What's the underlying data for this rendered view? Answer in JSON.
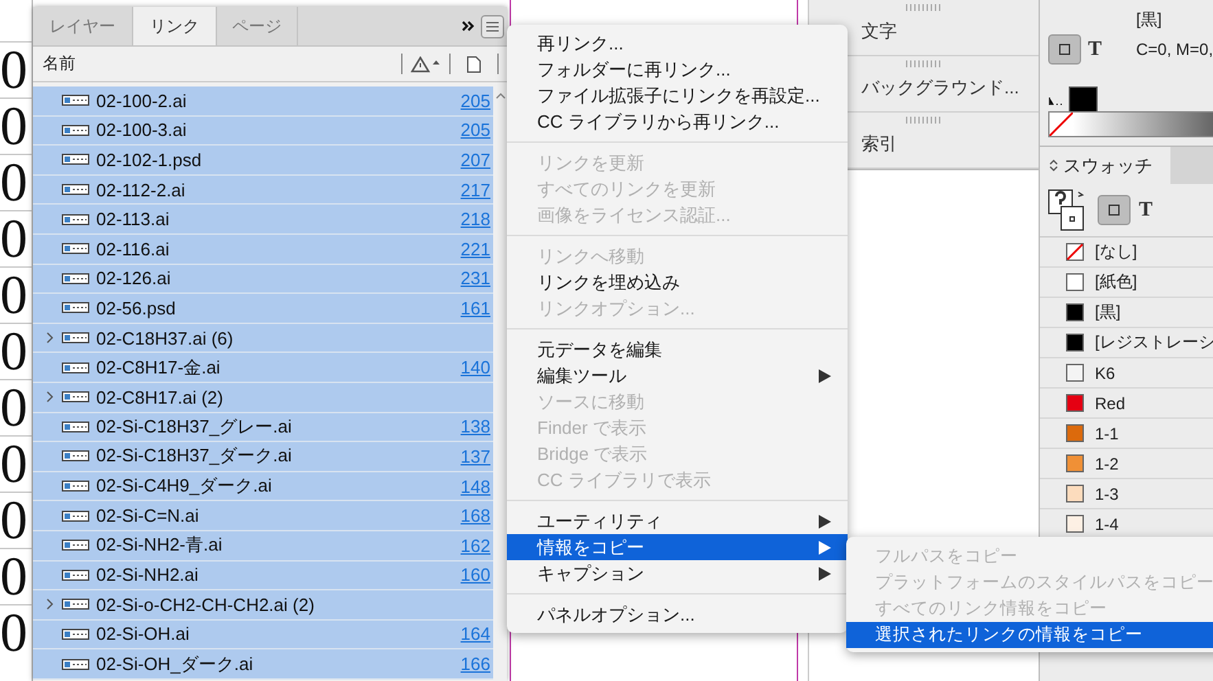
{
  "document": {
    "cells": [
      "0",
      "0",
      "0",
      "0",
      "0",
      "0",
      "0",
      "0",
      "0",
      "0",
      "0"
    ]
  },
  "links_panel": {
    "tabs": [
      {
        "label": "レイヤー",
        "selected": false
      },
      {
        "label": "リンク",
        "selected": true
      },
      {
        "label": "ページ",
        "selected": false
      }
    ],
    "name_column": "名前",
    "rows": [
      {
        "kind": "file",
        "name": "02-100-2.ai",
        "page": "205",
        "selected": true
      },
      {
        "kind": "file",
        "name": "02-100-3.ai",
        "page": "205",
        "selected": true
      },
      {
        "kind": "file",
        "name": "02-102-1.psd",
        "page": "207",
        "selected": true
      },
      {
        "kind": "file",
        "name": "02-112-2.ai",
        "page": "217",
        "selected": true
      },
      {
        "kind": "file",
        "name": "02-113.ai",
        "page": "218",
        "selected": true
      },
      {
        "kind": "file",
        "name": "02-116.ai",
        "page": "221",
        "selected": true
      },
      {
        "kind": "file",
        "name": "02-126.ai",
        "page": "231",
        "selected": true
      },
      {
        "kind": "file",
        "name": "02-56.psd",
        "page": "161",
        "selected": true
      },
      {
        "kind": "group",
        "name": "02-C18H37.ai (6)",
        "selected": true
      },
      {
        "kind": "file",
        "name": "02-C8H17-金.ai",
        "page": "140",
        "selected": true
      },
      {
        "kind": "group",
        "name": "02-C8H17.ai (2)",
        "selected": true
      },
      {
        "kind": "file",
        "name": "02-Si-C18H37_グレー.ai",
        "page": "138",
        "selected": true
      },
      {
        "kind": "file",
        "name": "02-Si-C18H37_ダーク.ai",
        "page": "137",
        "selected": true
      },
      {
        "kind": "file",
        "name": "02-Si-C4H9_ダーク.ai",
        "page": "148",
        "selected": true
      },
      {
        "kind": "file",
        "name": "02-Si-C=N.ai",
        "page": "168",
        "selected": true
      },
      {
        "kind": "file",
        "name": "02-Si-NH2-青.ai",
        "page": "162",
        "selected": true
      },
      {
        "kind": "file",
        "name": "02-Si-NH2.ai",
        "page": "160",
        "selected": true
      },
      {
        "kind": "group",
        "name": "02-Si-o-CH2-CH-CH2.ai (2)",
        "selected": true
      },
      {
        "kind": "file",
        "name": "02-Si-OH.ai",
        "page": "164",
        "selected": true
      },
      {
        "kind": "file",
        "name": "02-Si-OH_ダーク.ai",
        "page": "166",
        "selected": true
      }
    ]
  },
  "collapsed_panels": [
    {
      "label": "文字"
    },
    {
      "label": "バックグラウンド..."
    },
    {
      "label": "索引"
    }
  ],
  "color_panel": {
    "swatch_name": "[黒]",
    "format_label": "T",
    "values": "C=0, M=0,"
  },
  "swatches_panel": {
    "tab": "スウォッチ",
    "format_label": "T",
    "swatches": [
      {
        "kind": "none",
        "name": "[なし]"
      },
      {
        "kind": "color",
        "name": "[紙色]",
        "color": "#ffffff"
      },
      {
        "kind": "color",
        "name": "[黒]",
        "color": "#000000"
      },
      {
        "kind": "color",
        "name": "[レジストレーシ",
        "color": "#000000"
      },
      {
        "kind": "color",
        "name": "K6",
        "color": "#f4f4f4"
      },
      {
        "kind": "color",
        "name": "Red",
        "color": "#e50012"
      },
      {
        "kind": "color",
        "name": "1-1",
        "color": "#dc6a0c"
      },
      {
        "kind": "color",
        "name": "1-2",
        "color": "#f09036"
      },
      {
        "kind": "color",
        "name": "1-3",
        "color": "#fcdcbd"
      },
      {
        "kind": "color",
        "name": "1-4",
        "color": "#fdf0e4"
      }
    ]
  },
  "menu": {
    "groups": [
      [
        {
          "label": "再リンク...",
          "disabled": false,
          "submenu": false,
          "selected": false
        },
        {
          "label": "フォルダーに再リンク...",
          "disabled": false,
          "submenu": false,
          "selected": false
        },
        {
          "label": "ファイル拡張子にリンクを再設定...",
          "disabled": false,
          "submenu": false,
          "selected": false
        },
        {
          "label": "CC ライブラリから再リンク...",
          "disabled": false,
          "submenu": false,
          "selected": false
        }
      ],
      [
        {
          "label": "リンクを更新",
          "disabled": true,
          "submenu": false,
          "selected": false
        },
        {
          "label": "すべてのリンクを更新",
          "disabled": true,
          "submenu": false,
          "selected": false
        },
        {
          "label": "画像をライセンス認証...",
          "disabled": true,
          "submenu": false,
          "selected": false
        }
      ],
      [
        {
          "label": "リンクへ移動",
          "disabled": true,
          "submenu": false,
          "selected": false
        },
        {
          "label": "リンクを埋め込み",
          "disabled": false,
          "submenu": false,
          "selected": false
        },
        {
          "label": "リンクオプション...",
          "disabled": true,
          "submenu": false,
          "selected": false
        }
      ],
      [
        {
          "label": "元データを編集",
          "disabled": false,
          "submenu": false,
          "selected": false
        },
        {
          "label": "編集ツール",
          "disabled": false,
          "submenu": true,
          "selected": false
        },
        {
          "label": "ソースに移動",
          "disabled": true,
          "submenu": false,
          "selected": false
        },
        {
          "label": "Finder で表示",
          "disabled": true,
          "submenu": false,
          "selected": false
        },
        {
          "label": "Bridge で表示",
          "disabled": true,
          "submenu": false,
          "selected": false
        },
        {
          "label": "CC ライブラリで表示",
          "disabled": true,
          "submenu": false,
          "selected": false
        }
      ],
      [
        {
          "label": "ユーティリティ",
          "disabled": false,
          "submenu": true,
          "selected": false
        },
        {
          "label": "情報をコピー",
          "disabled": false,
          "submenu": true,
          "selected": true
        },
        {
          "label": "キャプション",
          "disabled": false,
          "submenu": true,
          "selected": false
        }
      ],
      [
        {
          "label": "パネルオプション...",
          "disabled": false,
          "submenu": false,
          "selected": false
        }
      ]
    ]
  },
  "submenu": {
    "items": [
      {
        "label": "フルパスをコピー",
        "disabled": true,
        "selected": false
      },
      {
        "label": "プラットフォームのスタイルパスをコピー",
        "disabled": true,
        "selected": false
      },
      {
        "label": "すべてのリンク情報をコピー",
        "disabled": true,
        "selected": false
      },
      {
        "label": "選択されたリンクの情報をコピー",
        "disabled": false,
        "selected": true
      }
    ]
  }
}
